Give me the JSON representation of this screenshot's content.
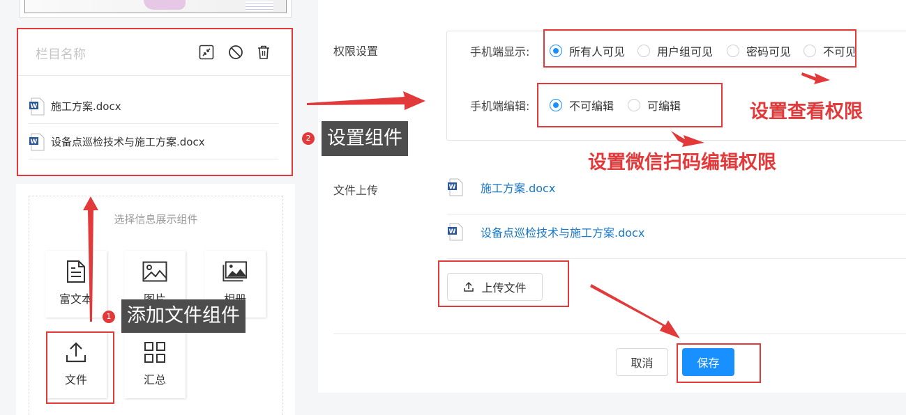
{
  "editor": {
    "card_title": "栏目名称",
    "files": [
      "施工方案.docx",
      "设备点巡检技术与施工方案.docx"
    ]
  },
  "selector": {
    "title": "选择信息展示组件",
    "components": [
      {
        "label": "富文本",
        "icon": "document-icon"
      },
      {
        "label": "图片",
        "icon": "image-icon"
      },
      {
        "label": "相册",
        "icon": "album-icon"
      },
      {
        "label": "文件",
        "icon": "upload-icon"
      },
      {
        "label": "汇总",
        "icon": "grid-icon"
      }
    ]
  },
  "form": {
    "permission_label": "权限设置",
    "mobile_display_label": "手机端显示:",
    "mobile_display_options": [
      "所有人可见",
      "用户组可见",
      "密码可见",
      "不可见"
    ],
    "mobile_display_selected": "所有人可见",
    "mobile_edit_label": "手机端编辑:",
    "mobile_edit_options": [
      "不可编辑",
      "可编辑"
    ],
    "mobile_edit_selected": "不可编辑",
    "upload_label": "文件上传",
    "uploaded_files": [
      "施工方案.docx",
      "设备点巡检技术与施工方案.docx"
    ],
    "upload_button": "上传文件",
    "cancel_button": "取消",
    "save_button": "保存"
  },
  "annotations": {
    "step1_badge": "1",
    "step1_text": "添加文件组件",
    "step2_badge": "2",
    "step2_text": "设置组件",
    "view_permission": "设置查看权限",
    "edit_permission": "设置微信扫码编辑权限"
  },
  "colors": {
    "primary": "#1890ff",
    "link": "#1677c8",
    "annotation_red": "#e23a3a",
    "tooltip_bg": "#4d4d4d"
  }
}
